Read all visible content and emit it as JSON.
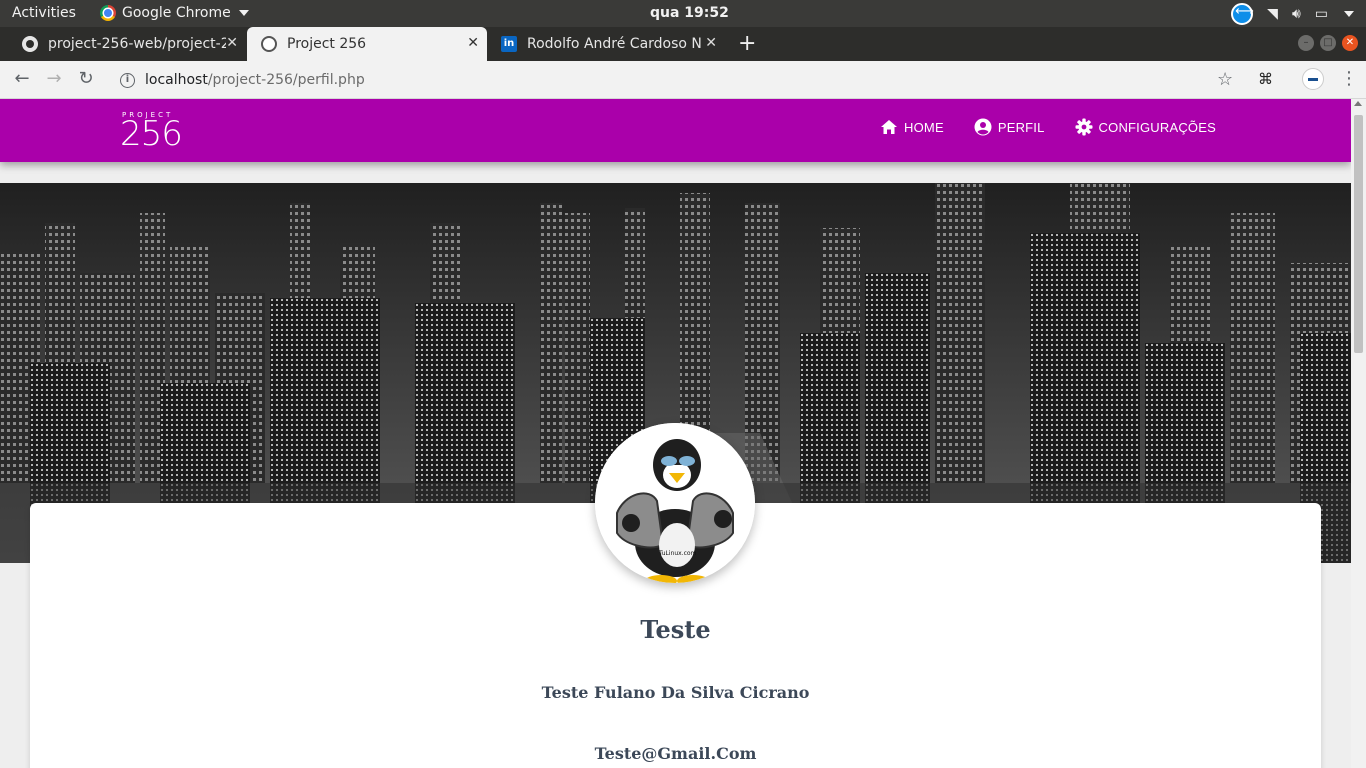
{
  "system_bar": {
    "activities": "Activities",
    "app_name": "Google Chrome",
    "clock": "qua 19:52"
  },
  "browser": {
    "tabs": [
      {
        "title": "project-256-web/project-2",
        "favicon": "github-icon",
        "active": false
      },
      {
        "title": "Project 256",
        "favicon": "page-icon",
        "active": true
      },
      {
        "title": "Rodolfo André Cardoso N",
        "favicon": "linkedin-icon",
        "active": false
      }
    ],
    "url_host": "localhost",
    "url_path": "/project-256/perfil.php"
  },
  "site": {
    "brand_small": "PROJECT",
    "brand_big": "256",
    "nav": [
      {
        "label": "HOME",
        "icon": "home-icon"
      },
      {
        "label": "PERFIL",
        "icon": "account-circle-icon"
      },
      {
        "label": "CONFIGURAÇÕES",
        "icon": "gear-icon"
      }
    ],
    "accent": "#aa00aa"
  },
  "profile": {
    "username": "Teste",
    "full_name": "Teste Fulano Da Silva Cicrano",
    "email": "Teste@Gmail.Com",
    "avatar_caption": "TuLinux.com"
  }
}
